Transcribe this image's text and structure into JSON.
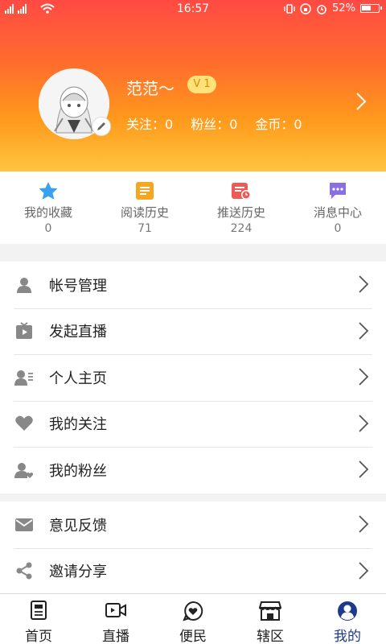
{
  "status": {
    "time": "16:57",
    "battery": "52%"
  },
  "profile": {
    "name": "范范～",
    "level": "V 1",
    "follow_label": "关注：0",
    "fans_label": "粉丝：0",
    "coins_label": "金币：0"
  },
  "quick": [
    {
      "label": "我的收藏",
      "value": "0",
      "icon": "star-icon",
      "color": "#3aa0f0"
    },
    {
      "label": "阅读历史",
      "value": "71",
      "icon": "document-icon",
      "color": "#f5a623"
    },
    {
      "label": "推送历史",
      "value": "224",
      "icon": "calendar-clock-icon",
      "color": "#ee5a55"
    },
    {
      "label": "消息中心",
      "value": "0",
      "icon": "chat-icon",
      "color": "#8a6fe0"
    }
  ],
  "menu1": [
    {
      "label": "帐号管理",
      "icon": "user-icon"
    },
    {
      "label": "发起直播",
      "icon": "tv-icon"
    },
    {
      "label": "个人主页",
      "icon": "profile-card-icon"
    },
    {
      "label": "我的关注",
      "icon": "heart-icon"
    },
    {
      "label": "我的粉丝",
      "icon": "user-heart-icon"
    }
  ],
  "menu2": [
    {
      "label": "意见反馈",
      "icon": "mail-icon"
    },
    {
      "label": "邀请分享",
      "icon": "share-icon"
    }
  ],
  "tabs": [
    {
      "label": "首页",
      "icon": "news-icon"
    },
    {
      "label": "直播",
      "icon": "video-icon"
    },
    {
      "label": "便民",
      "icon": "heart-bubble-icon"
    },
    {
      "label": "辖区",
      "icon": "store-icon"
    },
    {
      "label": "我的",
      "icon": "user-circle-icon",
      "active": true
    }
  ],
  "colors": {
    "active_tab": "#1e3a8a",
    "menu_icon": "#888888"
  }
}
